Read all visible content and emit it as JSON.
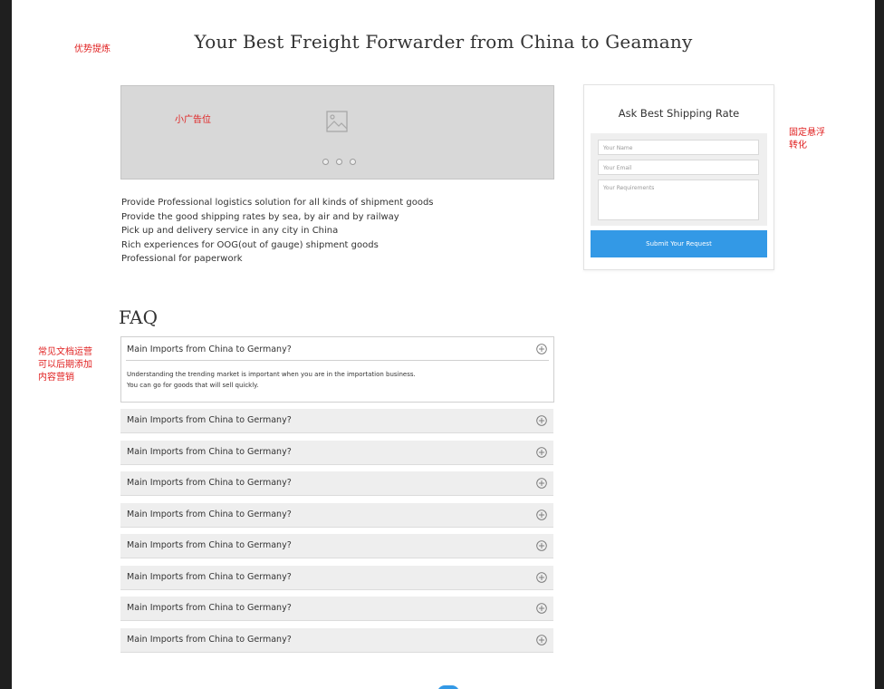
{
  "annotations": {
    "advantages": "优势提炼",
    "banner_ad": "小广告位",
    "sticky_form": [
      "固定悬浮",
      "转化"
    ],
    "faq_note": [
      "常见文档运营",
      "可以后期添加",
      "内容营销"
    ]
  },
  "page_title": "Your Best Freight Forwarder from China to Geamany",
  "features": [
    "Provide Professional logistics solution for all kinds of shipment goods",
    "Provide the good shipping rates by sea, by air and by railway",
    "Pick up and delivery service in any city in China",
    "Rich experiences for OOG(out of gauge) shipment goods",
    "Professional for paperwork"
  ],
  "form": {
    "title": "Ask Best Shipping Rate",
    "name_placeholder": "Your Name",
    "email_placeholder": "Your Email",
    "requirements_placeholder": "Your Requirements",
    "submit_label": "Submit Your Request"
  },
  "faq": {
    "title": "FAQ",
    "open_item": {
      "question": "Main Imports from China to Germany?",
      "answer_lines": [
        "Understanding the trending market is important when you are in the importation business.",
        "You can go for goods that will sell quickly."
      ]
    },
    "items": [
      "Main Imports from China to Germany?",
      "Main Imports from China to Germany?",
      "Main Imports from China to Germany?",
      "Main Imports from China to Germany?",
      "Main Imports from China to Germany?",
      "Main Imports from China to Germany?",
      "Main Imports from China to Germany?",
      "Main Imports from China to Germany?"
    ]
  },
  "colors": {
    "annotation": "#e02020",
    "accent": "#3399e6",
    "banner_bg": "#d8d8d8",
    "faq_item_bg": "#eeeeee"
  },
  "icons": {
    "banner": "image-placeholder-icon",
    "faq_toggle": "plus-circle-icon"
  }
}
